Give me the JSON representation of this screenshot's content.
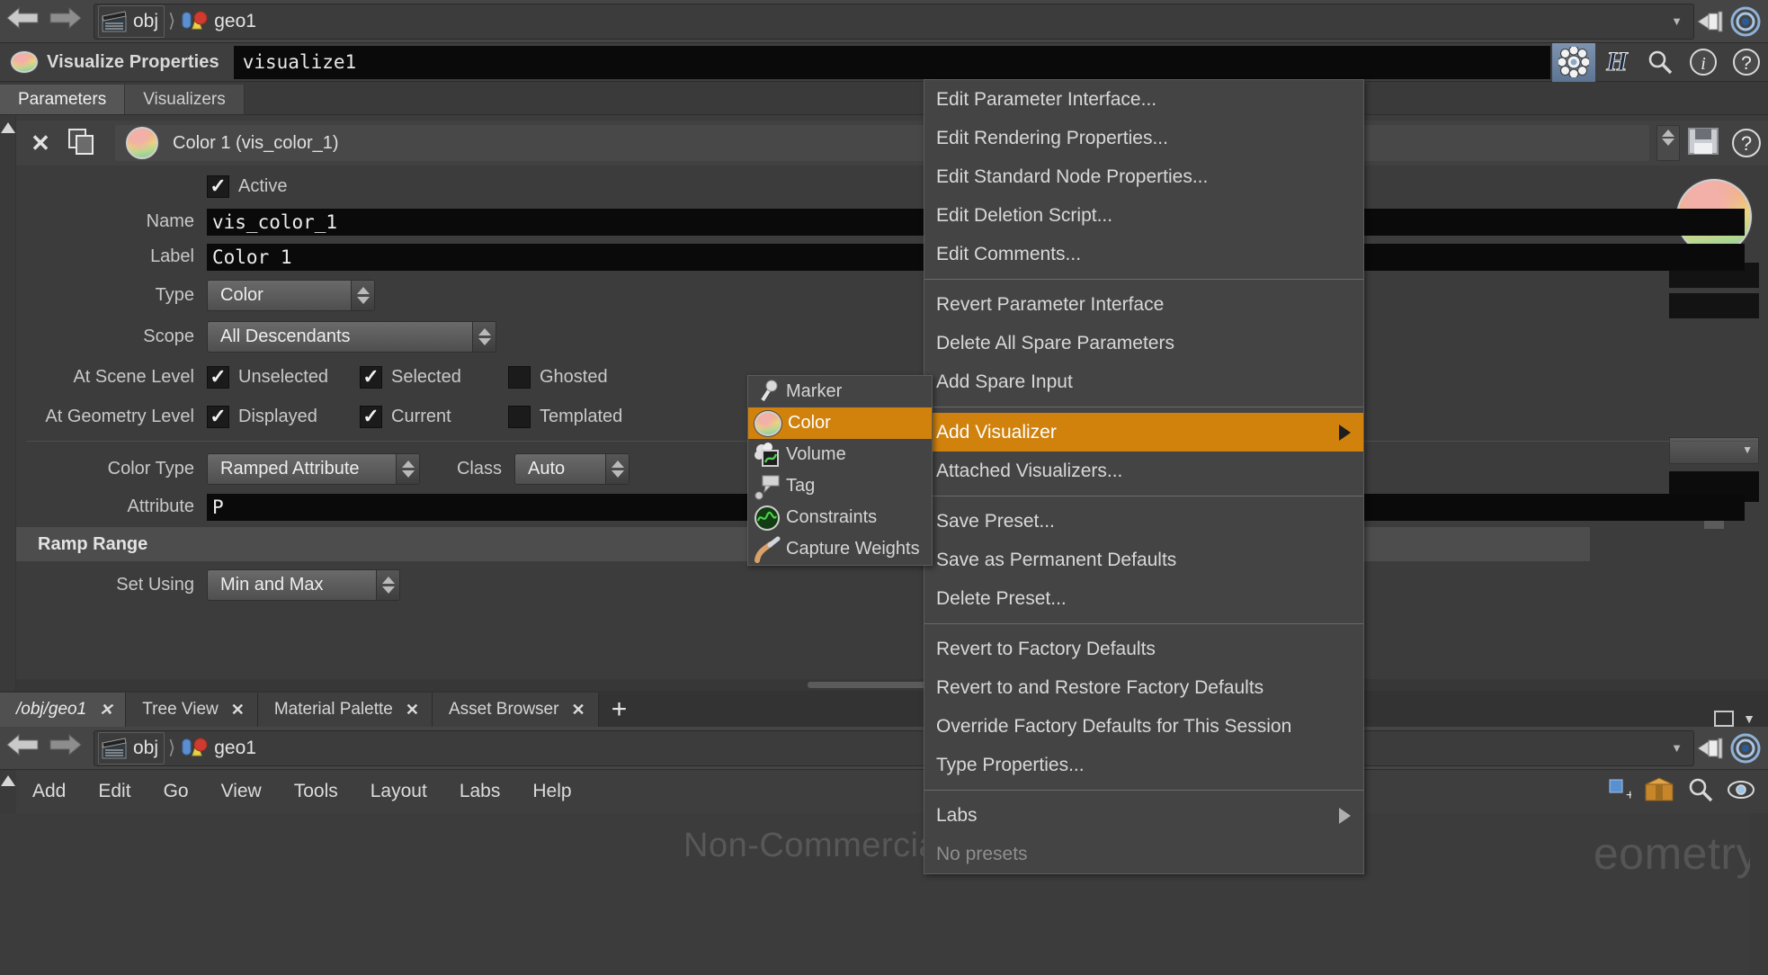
{
  "top_path": {
    "back_icon": "arrow-left-icon",
    "forward_icon": "arrow-right-icon",
    "crumbs": [
      {
        "label": "obj",
        "icon": "clapperboard-icon"
      },
      {
        "label": "geo1",
        "icon": "geometry-object-icon"
      }
    ],
    "separator": "›",
    "caret": "▼",
    "pin_icon": "pin-icon",
    "target_icon": "target-icon"
  },
  "visualize_header": {
    "icon": "visualize-ramp-icon",
    "title": "Visualize Properties",
    "node_name": "visualize1",
    "tools": [
      {
        "name": "gear-icon",
        "glyph": "⚙"
      },
      {
        "name": "houdini-h-icon",
        "glyph": "H"
      },
      {
        "name": "search-icon",
        "glyph": "⌕"
      },
      {
        "name": "info-icon",
        "glyph": "i"
      },
      {
        "name": "help-icon",
        "glyph": "?"
      }
    ]
  },
  "param_tabs": [
    {
      "label": "Parameters",
      "selected": true
    },
    {
      "label": "Visualizers",
      "selected": false
    }
  ],
  "visualizer_strip": {
    "close_label": "✕",
    "duplicate_icon": "duplicate-icon",
    "chip_icon": "color-ramp-icon",
    "chip_label": "Color 1 (vis_color_1)",
    "help_glyph": "?"
  },
  "parameters": {
    "active": {
      "label": "Active",
      "checked": true
    },
    "name": {
      "label": "Name",
      "value": "vis_color_1"
    },
    "label": {
      "label": "Label",
      "value": "Color 1"
    },
    "type": {
      "label": "Type",
      "value": "Color"
    },
    "scope": {
      "label": "Scope",
      "value": "All Descendants"
    },
    "scene_level": {
      "label": "At Scene Level",
      "items": [
        {
          "label": "Unselected",
          "checked": true
        },
        {
          "label": "Selected",
          "checked": true
        },
        {
          "label": "Ghosted",
          "checked": false
        }
      ]
    },
    "geometry_level": {
      "label": "At Geometry Level",
      "items": [
        {
          "label": "Displayed",
          "checked": true
        },
        {
          "label": "Current",
          "checked": true
        },
        {
          "label": "Templated",
          "checked": false
        }
      ]
    },
    "color_type": {
      "label": "Color Type",
      "value": "Ramped Attribute"
    },
    "class": {
      "label": "Class",
      "value": "Auto"
    },
    "attribute": {
      "label": "Attribute",
      "value": "P"
    },
    "ramp_range_section": "Ramp Range",
    "set_using": {
      "label": "Set Using",
      "value": "Min and Max"
    }
  },
  "context_menu": {
    "groups": [
      {
        "items": [
          {
            "label": "Edit Parameter Interface...",
            "state": "normal"
          },
          {
            "label": "Edit Rendering Properties...",
            "state": "normal"
          },
          {
            "label": "Edit Standard Node Properties...",
            "state": "normal"
          },
          {
            "label": "Edit Deletion Script...",
            "state": "normal"
          },
          {
            "label": "Edit Comments...",
            "state": "normal"
          }
        ]
      },
      {
        "items": [
          {
            "label": "Revert Parameter Interface",
            "state": "normal"
          },
          {
            "label": "Delete All Spare Parameters",
            "state": "normal"
          },
          {
            "label": "Add Spare Input",
            "state": "normal"
          }
        ]
      },
      {
        "items": [
          {
            "label": "Add Visualizer",
            "state": "highlighted",
            "submenu": true
          },
          {
            "label": "Attached Visualizers...",
            "state": "normal"
          }
        ]
      },
      {
        "items": [
          {
            "label": "Save Preset...",
            "state": "normal"
          },
          {
            "label": "Save as Permanent Defaults",
            "state": "normal"
          },
          {
            "label": "Delete Preset...",
            "state": "normal"
          }
        ]
      },
      {
        "items": [
          {
            "label": "Revert to Factory Defaults",
            "state": "normal"
          },
          {
            "label": "Revert to and Restore Factory Defaults",
            "state": "normal"
          },
          {
            "label": "Override Factory Defaults for This Session",
            "state": "normal"
          },
          {
            "label": "Type Properties...",
            "state": "normal"
          }
        ]
      },
      {
        "items": [
          {
            "label": "Labs",
            "state": "normal",
            "submenu": true
          },
          {
            "label": "No presets",
            "state": "disabled"
          }
        ]
      }
    ]
  },
  "add_visualizer_submenu": [
    {
      "label": "Marker",
      "icon": "marker-pin-icon",
      "highlighted": false
    },
    {
      "label": "Color",
      "icon": "color-ramp-icon",
      "highlighted": true
    },
    {
      "label": "Volume",
      "icon": "volume-icon",
      "highlighted": false
    },
    {
      "label": "Tag",
      "icon": "tag-callout-icon",
      "highlighted": false
    },
    {
      "label": "Constraints",
      "icon": "constraints-icon",
      "highlighted": false
    },
    {
      "label": "Capture Weights",
      "icon": "capture-weights-icon",
      "highlighted": false
    }
  ],
  "bottom_tabs": [
    {
      "label": "/obj/geo1",
      "selected": true,
      "close": "✕"
    },
    {
      "label": "Tree View",
      "selected": false,
      "close": "✕"
    },
    {
      "label": "Material Palette",
      "selected": false,
      "close": "✕"
    },
    {
      "label": "Asset Browser",
      "selected": false,
      "close": "✕"
    }
  ],
  "bottom_tabs_add": "+",
  "bottom_path": {
    "crumbs": [
      {
        "label": "obj",
        "icon": "clapperboard-icon"
      },
      {
        "label": "geo1",
        "icon": "geometry-object-icon"
      }
    ],
    "caret": "▼"
  },
  "network_menu": [
    "Add",
    "Edit",
    "Go",
    "View",
    "Tools",
    "Layout",
    "Labs",
    "Help"
  ],
  "viewport": {
    "watermark": "Non-Commercial Edition",
    "right_label": "eometry"
  },
  "colors": {
    "highlight_orange": "#d0820d",
    "panel_bg": "#3c3c3c",
    "menu_bg": "#444444",
    "field_black": "#0a0a0a",
    "text": "#d2d2d2"
  }
}
